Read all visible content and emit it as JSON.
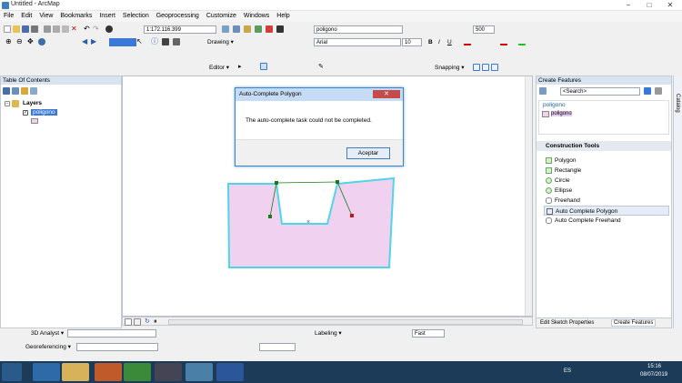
{
  "window": {
    "title": "Untitled - ArcMap",
    "min_icon": "−",
    "max_icon": "□",
    "close_icon": "✕"
  },
  "menu": [
    "File",
    "Edit",
    "View",
    "Bookmarks",
    "Insert",
    "Selection",
    "Geoprocessing",
    "Customize",
    "Windows",
    "Help"
  ],
  "toolbar": {
    "scale": "1:172.116.399",
    "layer": "poligono",
    "tolerance": "500",
    "drawing_label": "Drawing ▾",
    "font": "Arial",
    "font_size": "10",
    "bold": "B",
    "italic": "I",
    "underline": "U",
    "editor_label": "Editor ▾",
    "snapping_label": "Snapping ▾"
  },
  "toc": {
    "title": "Table Of Contents",
    "root": "Layers",
    "layer": "poligono"
  },
  "dialog": {
    "title": "Auto-Complete Polygon",
    "message": "The auto-complete task could not be completed.",
    "button": "Aceptar",
    "close": "✕"
  },
  "create_features": {
    "title": "Create Features",
    "search_placeholder": "<Search>",
    "group": "poligono",
    "template": "poligono",
    "construction_title": "Construction Tools",
    "tools": [
      "Polygon",
      "Rectangle",
      "Circle",
      "Ellipse",
      "Freehand",
      "Auto Complete Polygon",
      "Auto Complete Freehand"
    ],
    "selected_tool": "Auto Complete Polygon",
    "tab_edit": "Edit Sketch Properties",
    "tab_create": "Create Features"
  },
  "catalog_label": "Catalog",
  "bottom": {
    "analyst": "3D Analyst ▾",
    "georef": "Georeferencing ▾",
    "labeling": "Labeling ▾",
    "fast": "Fast"
  },
  "taskbar": {
    "lang": "ES",
    "time": "15:16",
    "date": "08/07/2019"
  },
  "colors": {
    "polygon_fill": "#f0d2f0",
    "polygon_outline": "#4fd5e8",
    "accent": "#3f83c8"
  }
}
